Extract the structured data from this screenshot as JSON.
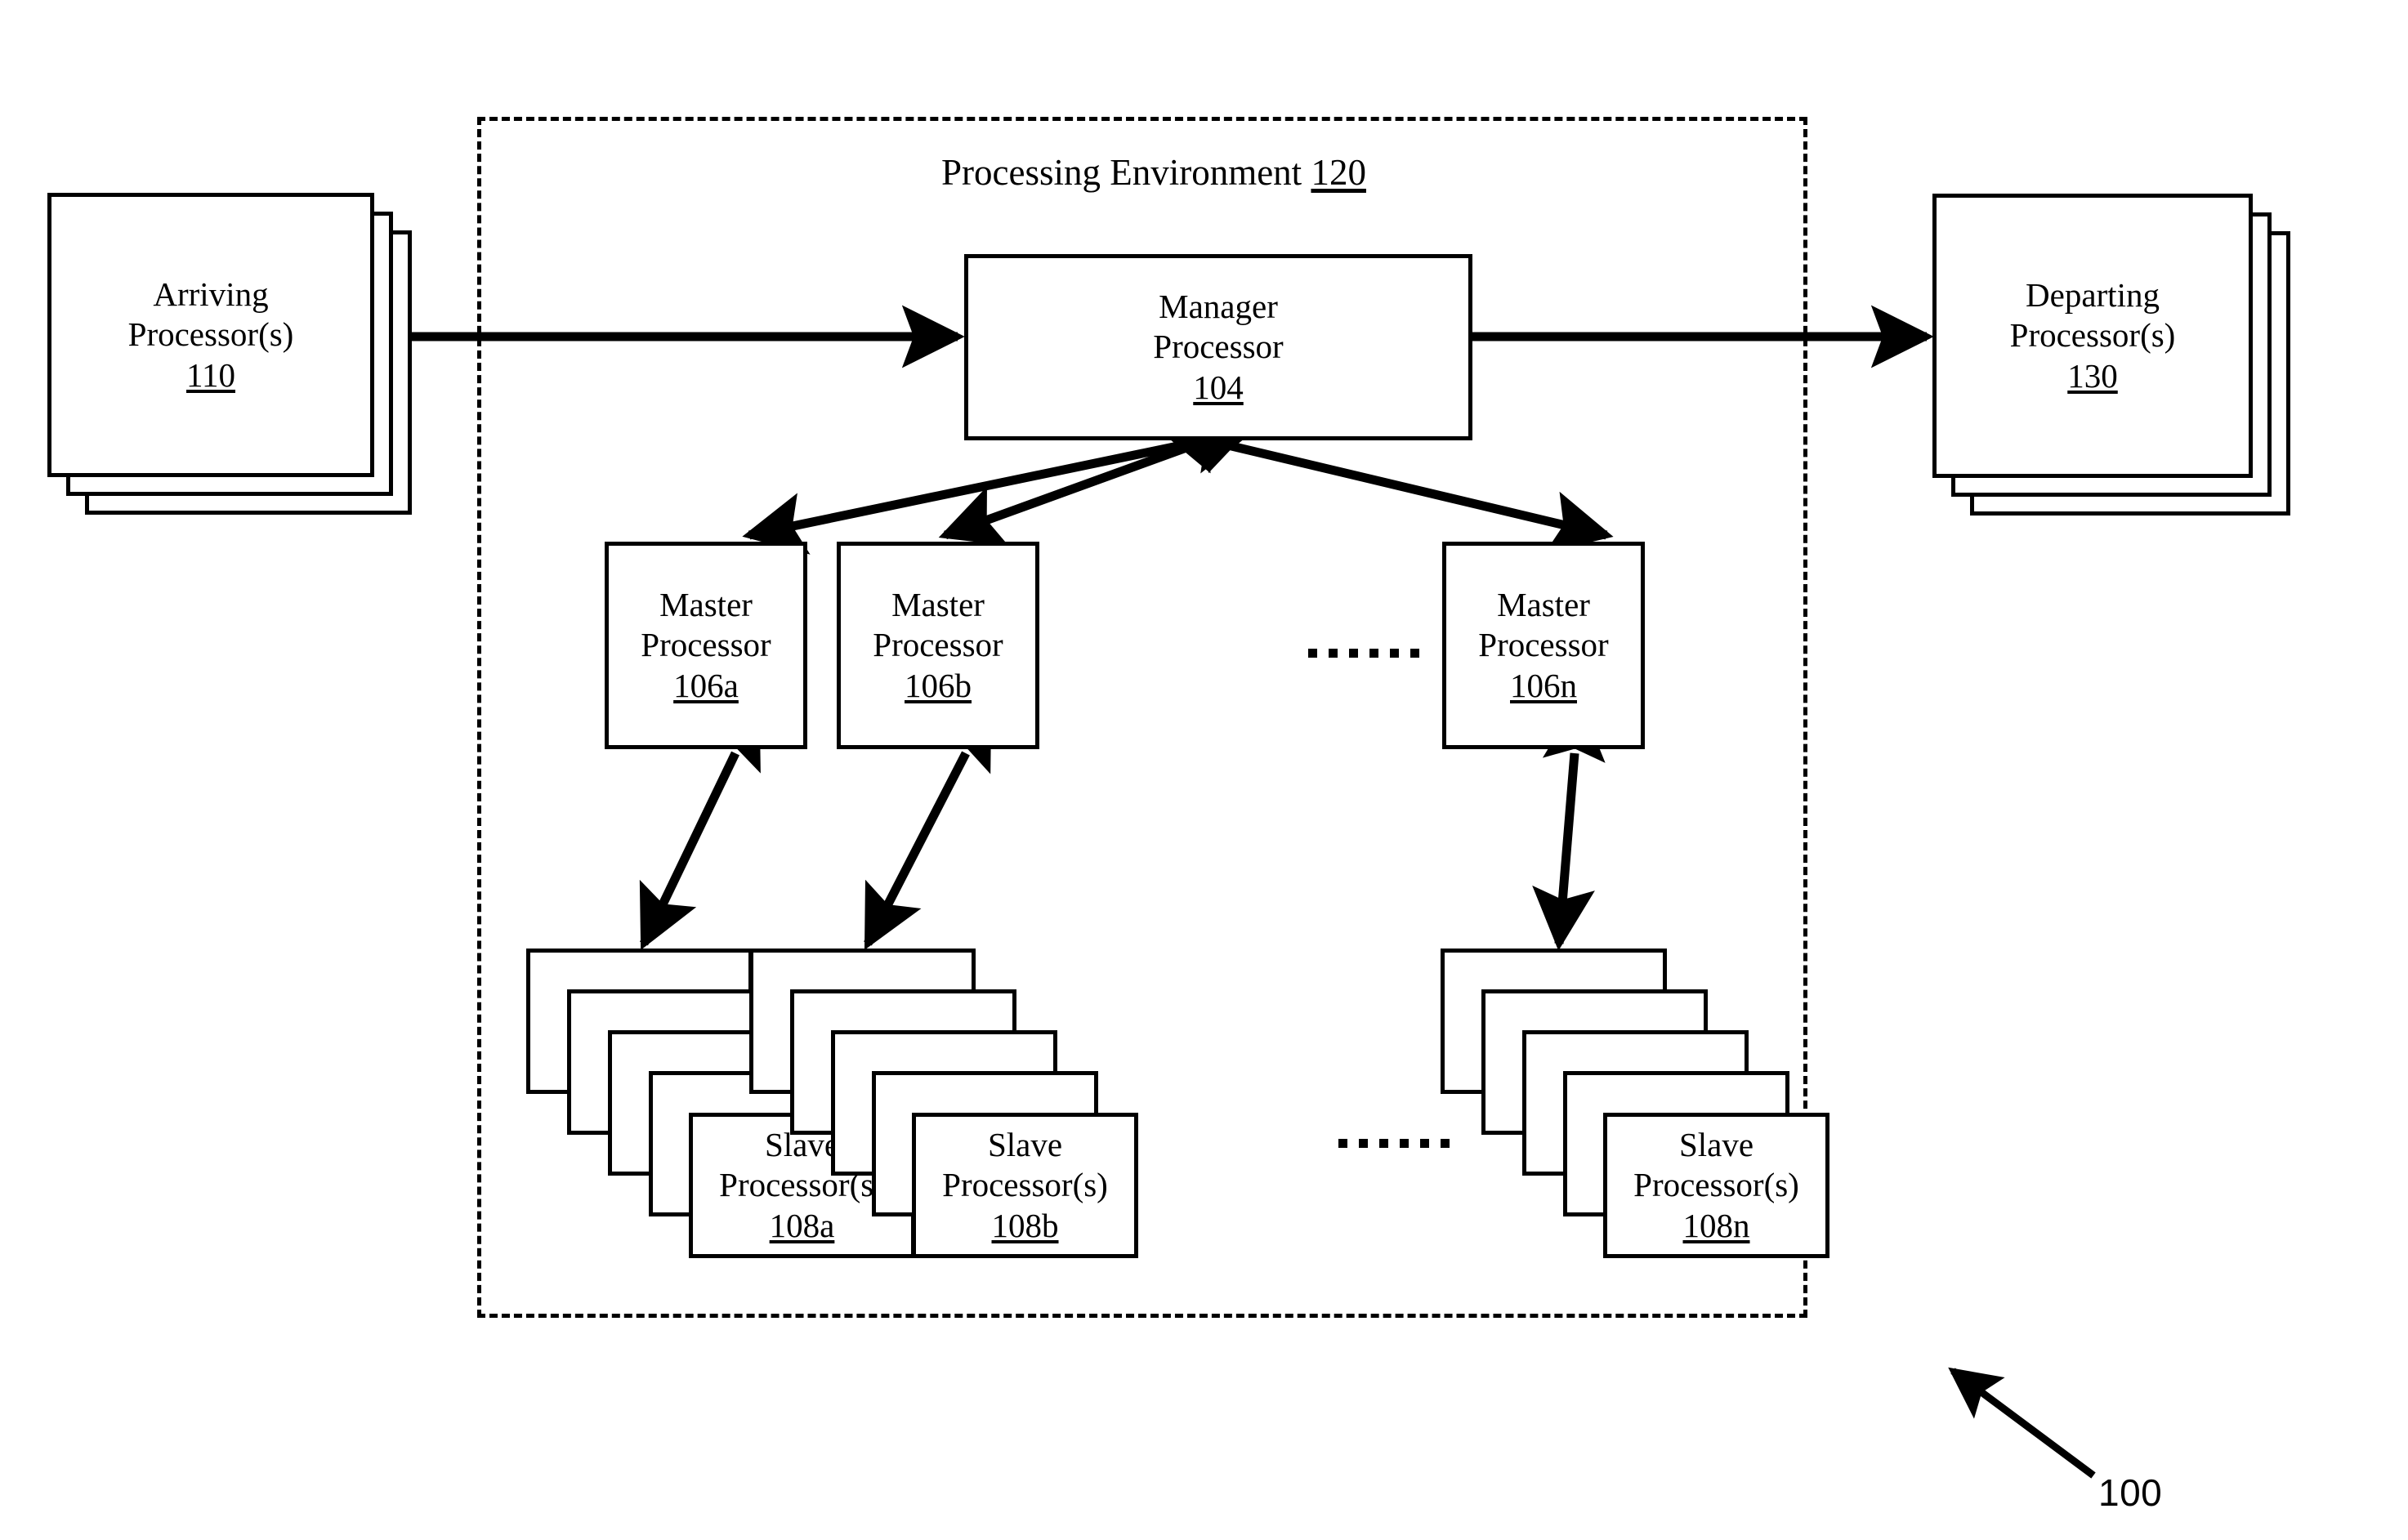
{
  "figure": {
    "number": "100",
    "number_arrow": "leader-arrow"
  },
  "environment": {
    "title_text": "Processing Environment",
    "reference": "120",
    "border_style": "dashed"
  },
  "nodes": {
    "arriving": {
      "line1": "Arriving",
      "line2": "Processor(s)",
      "reference": "110",
      "stack_count": 3
    },
    "departing": {
      "line1": "Departing",
      "line2": "Processor(s)",
      "reference": "130",
      "stack_count": 3
    },
    "manager": {
      "line1": "Manager",
      "line2": "Processor",
      "reference": "104"
    },
    "masters": [
      {
        "line1": "Master",
        "line2": "Processor",
        "reference": "106a"
      },
      {
        "line1": "Master",
        "line2": "Processor",
        "reference": "106b"
      },
      {
        "line1": "Master",
        "line2": "Processor",
        "reference": "106n"
      }
    ],
    "slaves": [
      {
        "line1": "Slave",
        "line2": "Processor(s)",
        "reference": "108a",
        "stack_count": 5
      },
      {
        "line1": "Slave",
        "line2": "Processor(s)",
        "reference": "108b",
        "stack_count": 5
      },
      {
        "line1": "Slave",
        "line2": "Processor(s)",
        "reference": "108n",
        "stack_count": 5
      }
    ]
  },
  "ellipses": {
    "master_row": "......",
    "slave_row": "......",
    "dot_count": 6
  },
  "connectors": [
    {
      "from": "110",
      "to": "104",
      "heads": "single"
    },
    {
      "from": "104",
      "to": "130",
      "heads": "single"
    },
    {
      "from": "104",
      "to": "106a",
      "heads": "double"
    },
    {
      "from": "104",
      "to": "106b",
      "heads": "double"
    },
    {
      "from": "104",
      "to": "106n",
      "heads": "double"
    },
    {
      "from": "106a",
      "to": "108a",
      "heads": "double"
    },
    {
      "from": "106b",
      "to": "108b",
      "heads": "double"
    },
    {
      "from": "106n",
      "to": "108n",
      "heads": "double"
    }
  ],
  "colors": {
    "stroke": "#000000",
    "fill": "#ffffff",
    "text": "#000000"
  }
}
